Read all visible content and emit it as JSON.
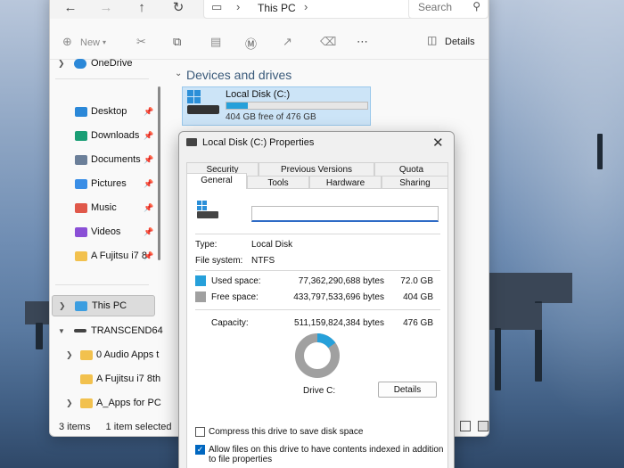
{
  "colors": {
    "used_space": "#26a0da",
    "free_space": "#a0a0a0",
    "accent": "#0067c0",
    "tile_bg": "#cce4f7"
  },
  "explorer": {
    "address": {
      "icon": "monitor-icon",
      "path_label": "This PC"
    },
    "search": {
      "placeholder": "Search"
    },
    "toolbar": {
      "new_label": "New",
      "details_label": "Details"
    },
    "sidebar": {
      "onedrive": "OneDrive",
      "quick_access": [
        {
          "label": "Desktop",
          "icon": "desktop-icon",
          "color": "#2b88d8"
        },
        {
          "label": "Downloads",
          "icon": "download-icon",
          "color": "#1a9e75"
        },
        {
          "label": "Documents",
          "icon": "document-icon",
          "color": "#6b7f99"
        },
        {
          "label": "Pictures",
          "icon": "pictures-icon",
          "color": "#3a8ee6"
        },
        {
          "label": "Music",
          "icon": "music-icon",
          "color": "#e0584a"
        },
        {
          "label": "Videos",
          "icon": "video-icon",
          "color": "#8a4fd6"
        },
        {
          "label": "A Fujitsu i7 8",
          "icon": "folder-icon",
          "color": "#f2c14e"
        }
      ],
      "this_pc": "This PC",
      "transcend": "TRANSCEND64",
      "transcend_children": [
        {
          "label": "0 Audio Apps t"
        },
        {
          "label": "A Fujitsu i7 8th"
        },
        {
          "label": "A_Apps for PC"
        }
      ]
    },
    "content": {
      "section_title": "Devices and drives",
      "drive": {
        "name": "Local Disk (C:)",
        "free_text": "404 GB free of 476 GB",
        "used_fraction": 0.15
      }
    },
    "status": {
      "items": "3 items",
      "selected": "1 item selected"
    }
  },
  "dialog": {
    "title": "Local Disk (C:) Properties",
    "tabs_row1": [
      "Security",
      "Previous Versions",
      "Quota"
    ],
    "tabs_row2": [
      "General",
      "Tools",
      "Hardware",
      "Sharing"
    ],
    "active_tab": "General",
    "label_value": "",
    "type_label": "Type:",
    "type_value": "Local Disk",
    "fs_label": "File system:",
    "fs_value": "NTFS",
    "used_label": "Used space:",
    "used_bytes": "77,362,290,688 bytes",
    "used_gb": "72.0 GB",
    "free_label": "Free space:",
    "free_bytes": "433,797,533,696 bytes",
    "free_gb": "404 GB",
    "capacity_label": "Capacity:",
    "capacity_bytes": "511,159,824,384 bytes",
    "capacity_gb": "476 GB",
    "drive_label": "Drive C:",
    "details_button": "Details",
    "compress_label": "Compress this drive to save disk space",
    "compress_checked": false,
    "index_label": "Allow files on this drive to have contents indexed in addition to file properties",
    "index_checked": true,
    "used_fraction": 0.1513
  }
}
